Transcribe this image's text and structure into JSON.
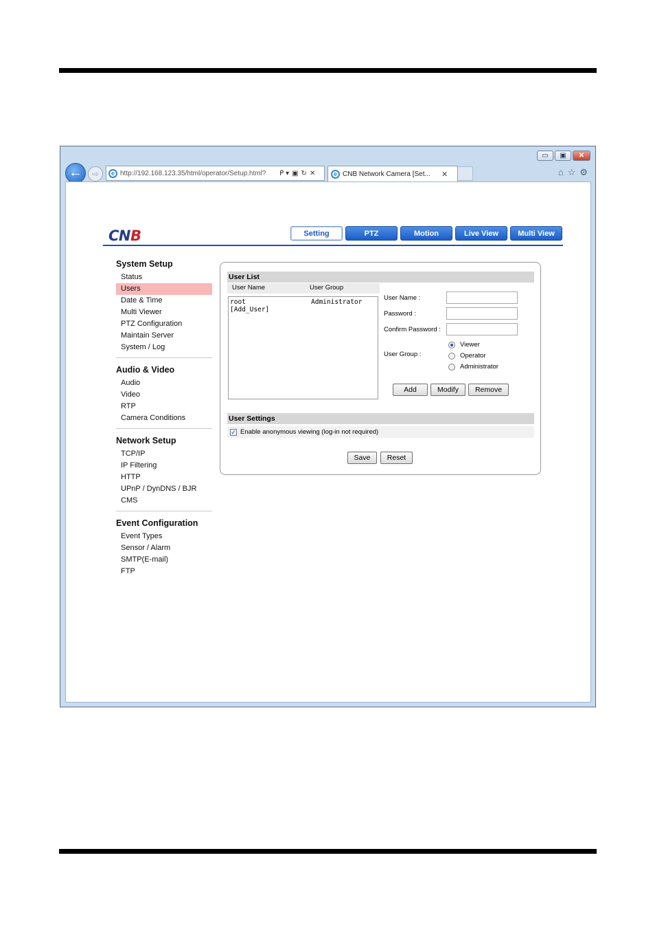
{
  "browser": {
    "url": "http://192.168.123.35/html/operator/Setup.html?",
    "tab_title": "CNB Network Camera [Set...",
    "window_controls": {
      "minimize": "▭",
      "maximize": "▣",
      "close": "✕"
    },
    "tab_close": "✕",
    "back_icon": "←",
    "forward_icon": "⇨",
    "addr_tools": {
      "search": "ᑭ ▾",
      "compat": "▣",
      "refresh": "↻",
      "stop": "✕"
    },
    "right_icons": {
      "home": "⌂",
      "favorites": "☆",
      "tools": "⚙"
    }
  },
  "app": {
    "logo_main": "CN",
    "logo_accent": "B",
    "nav": [
      "Setting",
      "PTZ",
      "Motion",
      "Live View",
      "Multi View"
    ],
    "active_nav": "Setting"
  },
  "sidebar": {
    "groups": [
      {
        "title": "System Setup",
        "items": [
          "Status",
          "Users",
          "Date & Time",
          "Multi Viewer",
          "PTZ Configuration",
          "Maintain Server",
          "System / Log"
        ]
      },
      {
        "title": "Audio & Video",
        "items": [
          "Audio",
          "Video",
          "RTP",
          "Camera Conditions"
        ]
      },
      {
        "title": "Network Setup",
        "items": [
          "TCP/IP",
          "IP Filtering",
          "HTTP",
          "UPnP / DynDNS / BJR",
          "CMS"
        ]
      },
      {
        "title": "Event Configuration",
        "items": [
          "Event Types",
          "Sensor / Alarm",
          "SMTP(E-mail)",
          "FTP"
        ]
      }
    ],
    "active_item": "Users"
  },
  "user_list": {
    "section_title": "User List",
    "col_name": "User Name",
    "col_group": "User Group",
    "rows": [
      {
        "name": "root",
        "group": "Administrator"
      },
      {
        "name": "[Add_User]",
        "group": ""
      }
    ]
  },
  "form": {
    "user_name_label": "User Name :",
    "password_label": "Password :",
    "confirm_label": "Confirm Password :",
    "user_group_label": "User Group :",
    "groups": [
      "Viewer",
      "Operator",
      "Administrator"
    ],
    "selected_group": "Viewer",
    "add": "Add",
    "modify": "Modify",
    "remove": "Remove"
  },
  "user_settings": {
    "section_title": "User Settings",
    "anonymous_label": "Enable anonymous viewing (log-in not required)",
    "anonymous_checked": true,
    "check_mark": "✓",
    "save": "Save",
    "reset": "Reset"
  }
}
